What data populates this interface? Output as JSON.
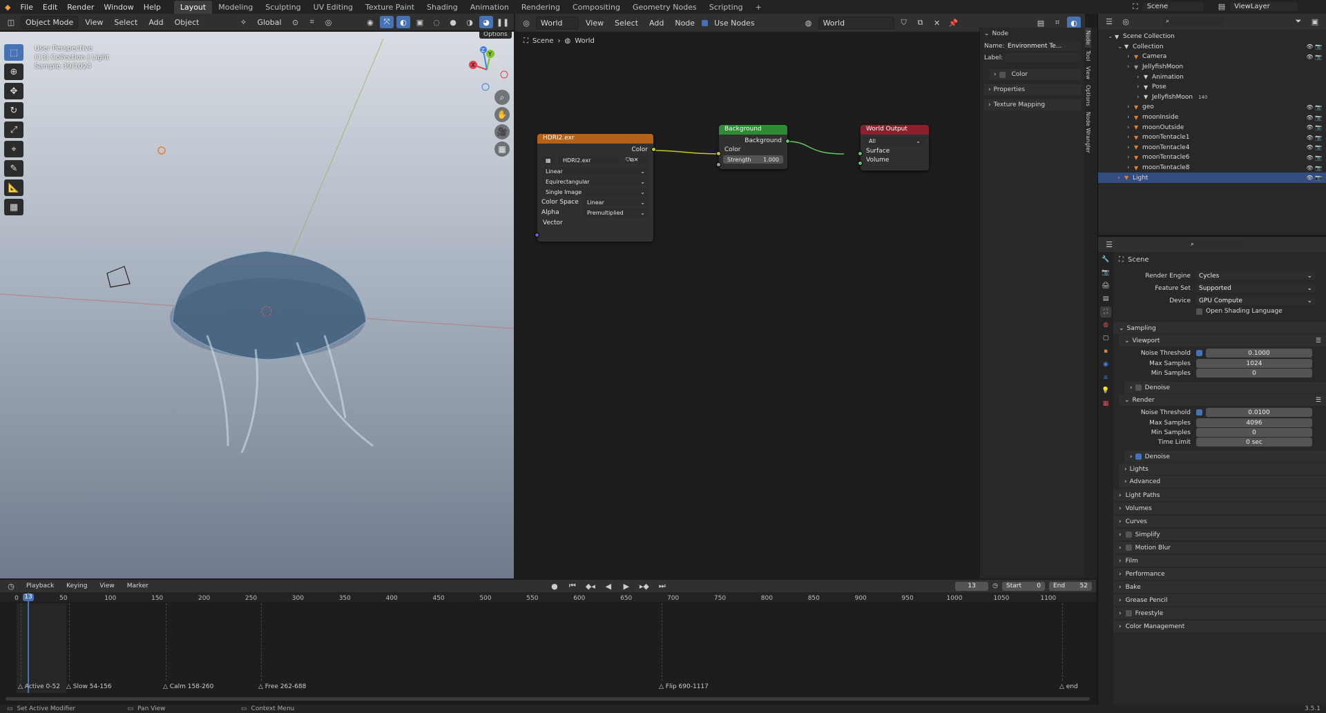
{
  "topbar": {
    "menus": [
      "File",
      "Edit",
      "Render",
      "Window",
      "Help"
    ],
    "workspaces": [
      "Layout",
      "Modeling",
      "Sculpting",
      "UV Editing",
      "Texture Paint",
      "Shading",
      "Animation",
      "Rendering",
      "Compositing",
      "Geometry Nodes",
      "Scripting"
    ],
    "active_workspace": "Layout",
    "scene": "Scene",
    "view_layer": "ViewLayer"
  },
  "viewport": {
    "mode": "Object Mode",
    "menus": [
      "View",
      "Select",
      "Add",
      "Object"
    ],
    "transform_orientation": "Global",
    "options_label": "Options",
    "overlay_lines": [
      "User Perspective",
      "(13) Collection | Light",
      "Sample 39/1024"
    ],
    "gizmo_axes": [
      "X",
      "Y",
      "Z"
    ]
  },
  "node_editor": {
    "editor_type": "World",
    "menus": [
      "View",
      "Select",
      "Add",
      "Node"
    ],
    "use_nodes_label": "Use Nodes",
    "world_name": "World",
    "breadcrumb": [
      "Scene",
      "World"
    ],
    "nodes": {
      "hdri": {
        "title": "HDRI2.exr",
        "output": "Color",
        "image": "HDRI2.exr",
        "interpolation": "Linear",
        "projection": "Equirectangular",
        "source": "Single Image",
        "color_space_label": "Color Space",
        "color_space": "Linear",
        "alpha_label": "Alpha",
        "alpha": "Premultiplied",
        "input": "Vector"
      },
      "background": {
        "title": "Background",
        "output": "Background",
        "input_color": "Color",
        "strength_label": "Strength",
        "strength": "1.000"
      },
      "world_output": {
        "title": "World Output",
        "target": "All",
        "surface": "Surface",
        "volume": "Volume"
      }
    }
  },
  "npanel": {
    "section": "Node",
    "name_label": "Name:",
    "name_value": "Environment Te...",
    "label_label": "Label:",
    "label_value": "",
    "subsections": [
      "Color",
      "Properties",
      "Texture Mapping"
    ],
    "tabs": [
      "Node",
      "Tool",
      "View",
      "Options",
      "Node Wrangler"
    ]
  },
  "outliner": {
    "rows": [
      {
        "label": "Scene Collection",
        "depth": 0,
        "icon": "collection-icon"
      },
      {
        "label": "Collection",
        "depth": 1,
        "icon": "collection-icon"
      },
      {
        "label": "Camera",
        "depth": 2,
        "icon": "camera-icon",
        "color": "#e08030"
      },
      {
        "label": "JellyfishMoon",
        "depth": 2,
        "icon": "armature-icon",
        "color": "#9a9a9a"
      },
      {
        "label": "Animation",
        "depth": 3,
        "icon": "animation-icon"
      },
      {
        "label": "Pose",
        "depth": 3,
        "icon": "pose-icon"
      },
      {
        "label": "JellyfishMoon",
        "depth": 3,
        "icon": "armature-data-icon",
        "badge": "140"
      },
      {
        "label": "geo",
        "depth": 2,
        "icon": "empty-icon",
        "color": "#e08030"
      },
      {
        "label": "moonInside",
        "depth": 2,
        "icon": "mesh-icon",
        "color": "#e08030"
      },
      {
        "label": "moonOutside",
        "depth": 2,
        "icon": "mesh-icon",
        "color": "#e08030"
      },
      {
        "label": "moonTentacle1",
        "depth": 2,
        "icon": "mesh-icon",
        "color": "#e08030"
      },
      {
        "label": "moonTentacle4",
        "depth": 2,
        "icon": "mesh-icon",
        "color": "#e08030"
      },
      {
        "label": "moonTentacle6",
        "depth": 2,
        "icon": "mesh-icon",
        "color": "#e08030"
      },
      {
        "label": "moonTentacle8",
        "depth": 2,
        "icon": "mesh-icon",
        "color": "#e08030"
      },
      {
        "label": "Light",
        "depth": 1,
        "icon": "light-icon",
        "selected": true,
        "color": "#e08030"
      }
    ]
  },
  "properties": {
    "context": "Scene",
    "render_engine_label": "Render Engine",
    "render_engine": "Cycles",
    "feature_set_label": "Feature Set",
    "feature_set": "Supported",
    "device_label": "Device",
    "device": "GPU Compute",
    "osl_label": "Open Shading Language",
    "sampling": "Sampling",
    "viewport": "Viewport",
    "vp_noise_label": "Noise Threshold",
    "vp_noise": "0.1000",
    "vp_max_label": "Max Samples",
    "vp_max": "1024",
    "vp_min_label": "Min Samples",
    "vp_min": "0",
    "denoise": "Denoise",
    "render": "Render",
    "r_noise_label": "Noise Threshold",
    "r_noise": "0.0100",
    "r_max_label": "Max Samples",
    "r_max": "4096",
    "r_min_label": "Min Samples",
    "r_min": "0",
    "r_time_label": "Time Limit",
    "r_time": "0 sec",
    "r_denoise": "Denoise",
    "lights": "Lights",
    "advanced": "Advanced",
    "sections": [
      "Light Paths",
      "Volumes",
      "Curves",
      "Simplify",
      "Motion Blur",
      "Film",
      "Performance",
      "Bake",
      "Grease Pencil",
      "Freestyle",
      "Color Management"
    ]
  },
  "timeline": {
    "menus": [
      "Playback",
      "Keying",
      "View",
      "Marker"
    ],
    "current_frame": "13",
    "start_label": "Start",
    "start": "0",
    "end_label": "End",
    "end": "52",
    "ticks": [
      "0",
      "50",
      "100",
      "150",
      "200",
      "250",
      "300",
      "350",
      "400",
      "450",
      "500",
      "550",
      "600",
      "650",
      "700",
      "750",
      "800",
      "850",
      "900",
      "950",
      "1000",
      "1050",
      "1100"
    ],
    "markers": [
      "Active 0-52",
      "Slow 54-156",
      "Calm 158-260",
      "Free 262-688",
      "Flip 690-1117",
      "end"
    ]
  },
  "statusbar": {
    "items": [
      "Set Active Modifier",
      "Pan View",
      "Context Menu"
    ],
    "version": "3.5.1"
  }
}
